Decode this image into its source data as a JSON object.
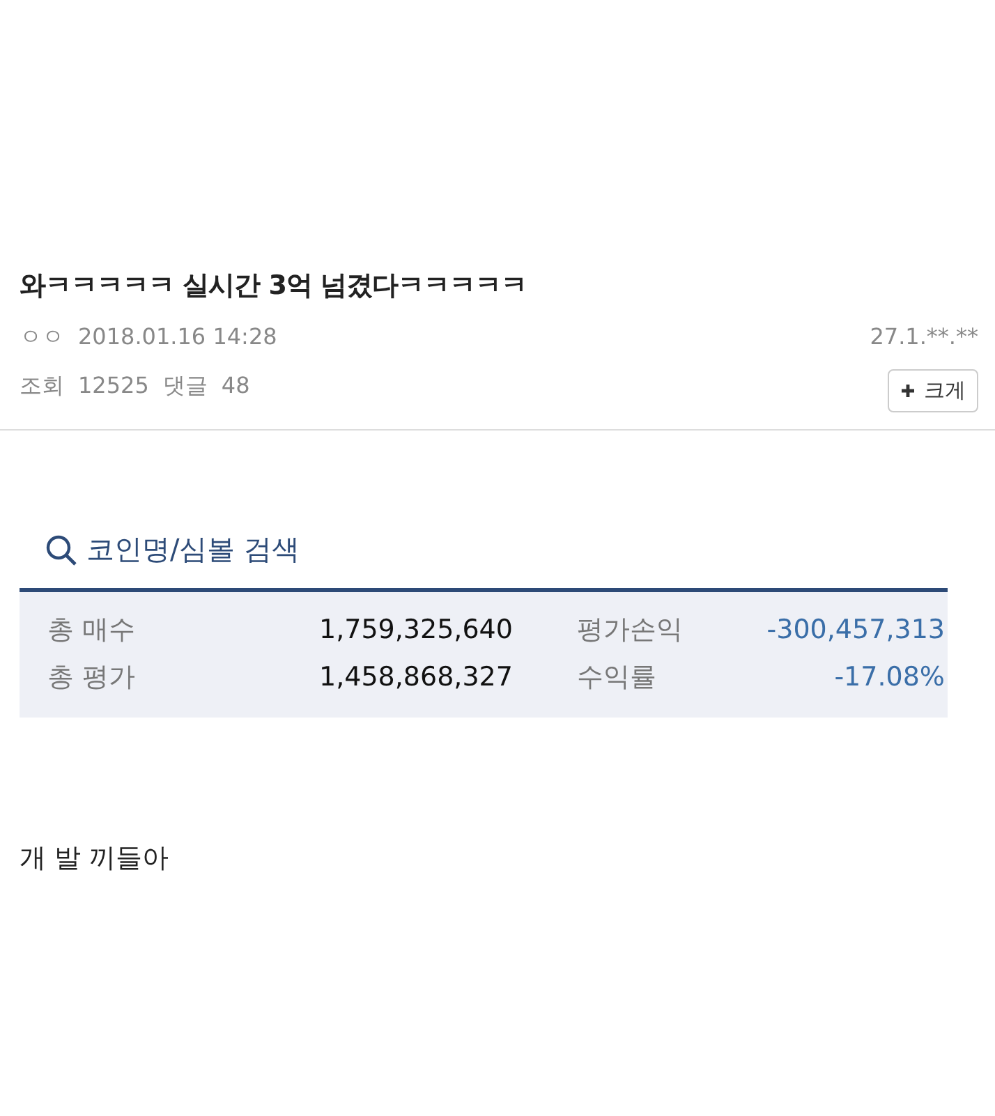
{
  "post": {
    "title": "와ㅋㅋㅋㅋㅋ 실시간 3억 넘겼다ㅋㅋㅋㅋㅋ",
    "author": "ㅇㅇ",
    "datetime": "2018.01.16 14:28",
    "ip": "27.1.**.**",
    "views_label": "조회",
    "views": "12525",
    "comments_label": "댓글",
    "comments": "48",
    "enlarge_button": "크게"
  },
  "search": {
    "label": "코인명/심볼 검색"
  },
  "summary": {
    "rows": [
      {
        "label": "총 매수",
        "value": "1,759,325,640",
        "label2": "평가손익",
        "value2": "-300,457,313"
      },
      {
        "label": "총 평가",
        "value": "1,458,868,327",
        "label2": "수익률",
        "value2": "-17.08%"
      }
    ]
  },
  "body": "개 발 끼들아"
}
